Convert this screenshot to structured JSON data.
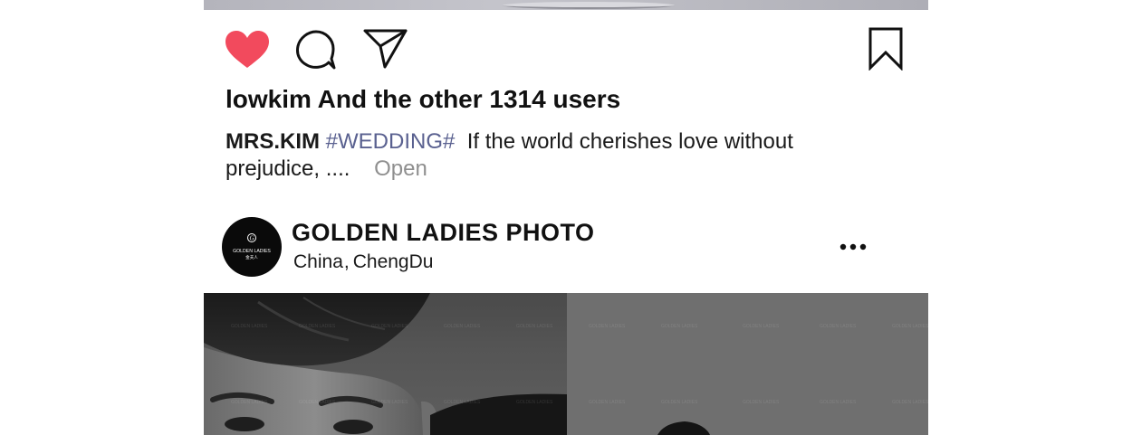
{
  "post": {
    "likes_text": "lowkim And the other 1314 users",
    "caption": {
      "author": "MRS.KIM",
      "hashtag": "#WEDDING#",
      "text": "If the world cherishes love without prejudice, ....",
      "more_label": "Open"
    },
    "actions": {
      "like_icon": "heart-icon",
      "comment_icon": "comment-icon",
      "share_icon": "send-icon",
      "save_icon": "bookmark-icon",
      "like_color": "#f24a5d"
    }
  },
  "next_post": {
    "account_name": "GOLDEN LADIES PHOTO",
    "location_country": "China",
    "location_separator": ",",
    "location_city": "ChengDu",
    "avatar": {
      "logo_text": "GOLDEN LADIES",
      "logo_subtext": "金夫人"
    },
    "menu_icon": "more-horizontal-icon",
    "watermark_text": "GOLDEN LADIES"
  }
}
